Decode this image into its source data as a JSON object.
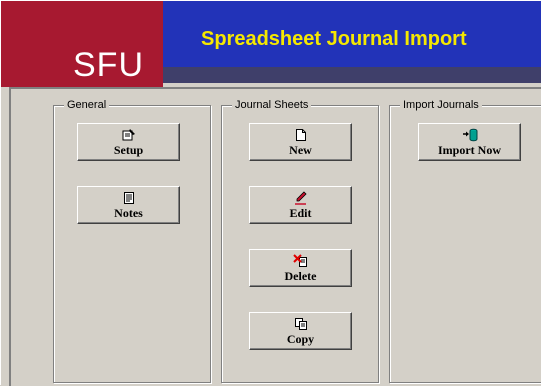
{
  "header": {
    "logo_text": "SFU",
    "title": "Spreadsheet Journal Import"
  },
  "groups": {
    "general": {
      "label": "General",
      "buttons": [
        {
          "label": "Setup",
          "icon": "setup-icon"
        },
        {
          "label": "Notes",
          "icon": "notes-icon"
        }
      ]
    },
    "journal_sheets": {
      "label": "Journal Sheets",
      "buttons": [
        {
          "label": "New",
          "icon": "new-document-icon"
        },
        {
          "label": "Edit",
          "icon": "pencil-icon"
        },
        {
          "label": "Delete",
          "icon": "delete-icon"
        },
        {
          "label": "Copy",
          "icon": "copy-icon"
        }
      ]
    },
    "import_journals": {
      "label": "Import Journals",
      "buttons": [
        {
          "label": "Import Now",
          "icon": "import-database-icon"
        }
      ]
    }
  },
  "colors": {
    "logo_red": "#a71930",
    "title_blue": "#2233b8",
    "title_yellow": "#f5e800",
    "face": "#d4d0c8"
  }
}
